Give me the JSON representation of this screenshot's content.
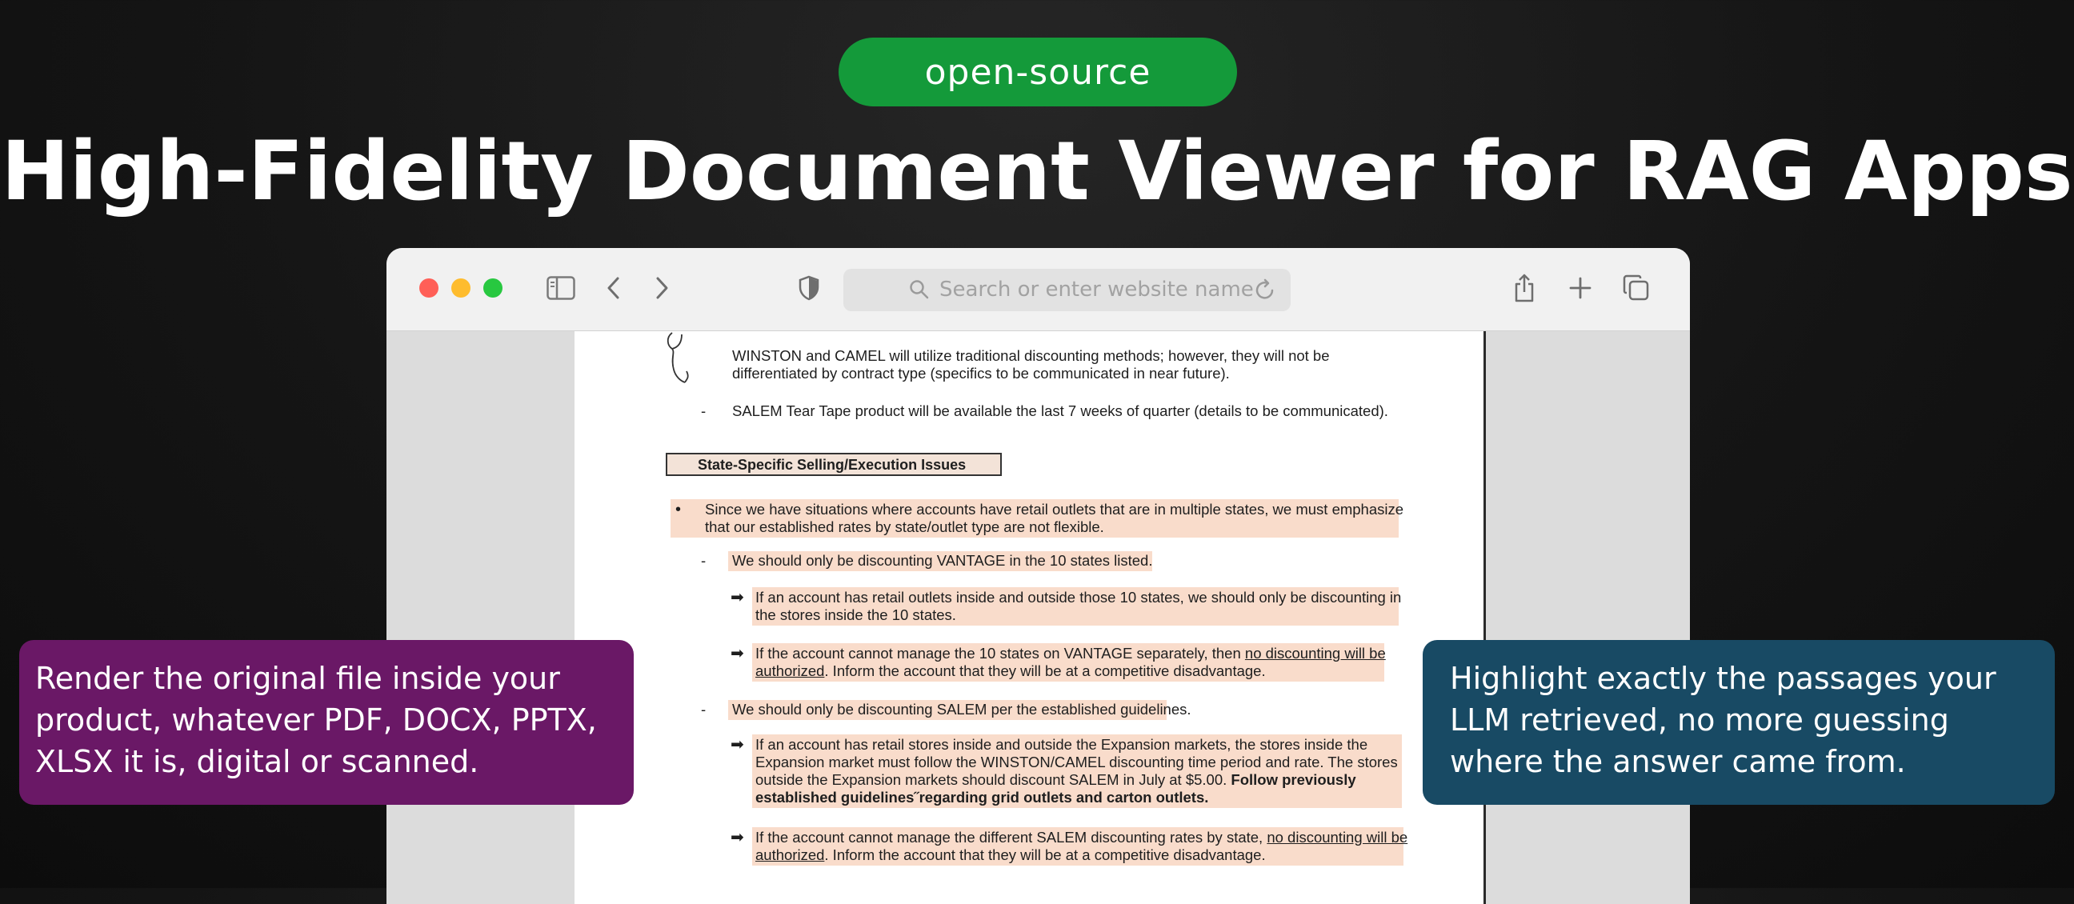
{
  "badge": {
    "label": "open-source",
    "color": "#149a3a"
  },
  "headline": "High-Fidelity Document Viewer for RAG Apps",
  "browser": {
    "toolbar": {
      "traffic_lights": [
        "#ff5f57",
        "#febc2e",
        "#28c840"
      ],
      "icons": [
        "sidebar-icon",
        "back-chevron-icon",
        "forward-chevron-icon",
        "shield-icon",
        "share-icon",
        "plus-icon",
        "tabs-icon"
      ],
      "address_placeholder": "Search or enter website name"
    }
  },
  "document": {
    "lines": {
      "l1": "WINSTON and CAMEL will utilize traditional discounting methods; however, they will not be",
      "l2": "differentiated by contract type (specifics to be communicated in near future).",
      "dash1": "-",
      "l3": "SALEM Tear Tape product will be available the last 7 weeks of quarter (details to be communicated).",
      "section_title": "State-Specific Selling/Execution Issues",
      "bullet": "•",
      "b1a": "Since we have situations where accounts have retail outlets that are in multiple states, we must emphasize",
      "b1b": "that our established rates by state/outlet type are not flexible.",
      "dash2": "-",
      "v1": "We should only be discounting VANTAGE in the 10 states listed.",
      "a1a": "If an account has retail outlets inside and outside those 10 states, we should only be discounting in",
      "a1b": "the stores inside the 10 states.",
      "a2a_pre": "If the account cannot manage the 10 states on VANTAGE separately, then ",
      "a2a_u": "no discounting will be",
      "a2b_u": "authorized",
      "a2b_post": ".  Inform the account that they will be at a competitive disadvantage.",
      "dash3": "-",
      "s1": "We should only be discounting SALEM per the established guidelines.",
      "a3a": "If an account has retail stores inside and outside the Expansion markets, the stores inside the",
      "a3b": "Expansion market must follow the WINSTON/CAMEL discounting time period and rate.  The stores",
      "a3c_pre": "outside the Expansion markets should discount SALEM in July at $5.00.  ",
      "a3c_bold": "Follow previously",
      "a3d_bold": "established guidelines˝regarding grid outlets and carton outlets.",
      "a4a_pre": "If the account cannot manage the different SALEM discounting rates by state, ",
      "a4a_u": "no discounting will be",
      "a4b_u": "authorized",
      "a4b_post": ".  Inform the account that they will be at a competitive disadvantage."
    },
    "highlight_color": "#f9dccb",
    "arrow_glyph": "➡"
  },
  "cards": {
    "left": {
      "lines": [
        "Render the original file inside your",
        "product, whatever PDF, DOCX, PPTX,",
        "XLSX it is, digital or scanned."
      ],
      "color": "#6a1866"
    },
    "right": {
      "lines": [
        "Highlight exactly the passages your",
        "LLM retrieved, no more guessing",
        "where the answer came from."
      ],
      "color": "#184a64"
    }
  }
}
